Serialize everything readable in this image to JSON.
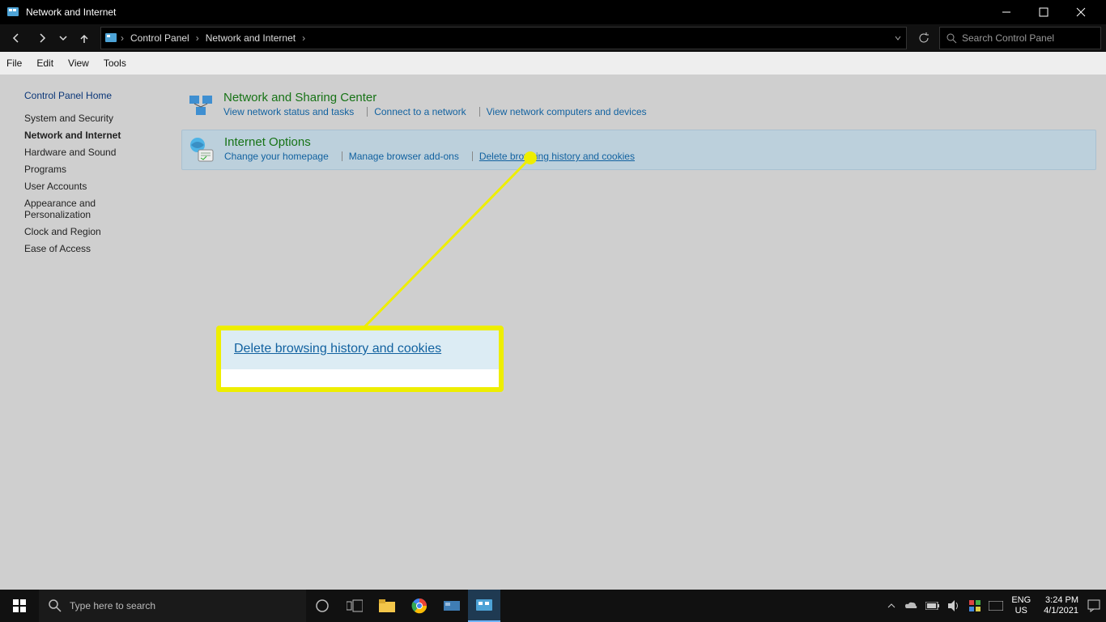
{
  "titlebar": {
    "title": "Network and Internet"
  },
  "breadcrumbs": {
    "root": "Control Panel",
    "current": "Network and Internet"
  },
  "search": {
    "placeholder": "Search Control Panel"
  },
  "menu": {
    "file": "File",
    "edit": "Edit",
    "view": "View",
    "tools": "Tools"
  },
  "sidebar": {
    "home": "Control Panel Home",
    "items": [
      "System and Security",
      "Network and Internet",
      "Hardware and Sound",
      "Programs",
      "User Accounts",
      "Appearance and Personalization",
      "Clock and Region",
      "Ease of Access"
    ]
  },
  "categories": [
    {
      "title": "Network and Sharing Center",
      "links": [
        "View network status and tasks",
        "Connect to a network",
        "View network computers and devices"
      ]
    },
    {
      "title": "Internet Options",
      "links": [
        "Change your homepage",
        "Manage browser add-ons",
        "Delete browsing history and cookies"
      ]
    }
  ],
  "callout": {
    "label": "Delete browsing history and cookies"
  },
  "taskbar": {
    "search_placeholder": "Type here to search",
    "lang_primary": "ENG",
    "lang_secondary": "US",
    "clock_time": "3:24 PM",
    "clock_date": "4/1/2021"
  }
}
